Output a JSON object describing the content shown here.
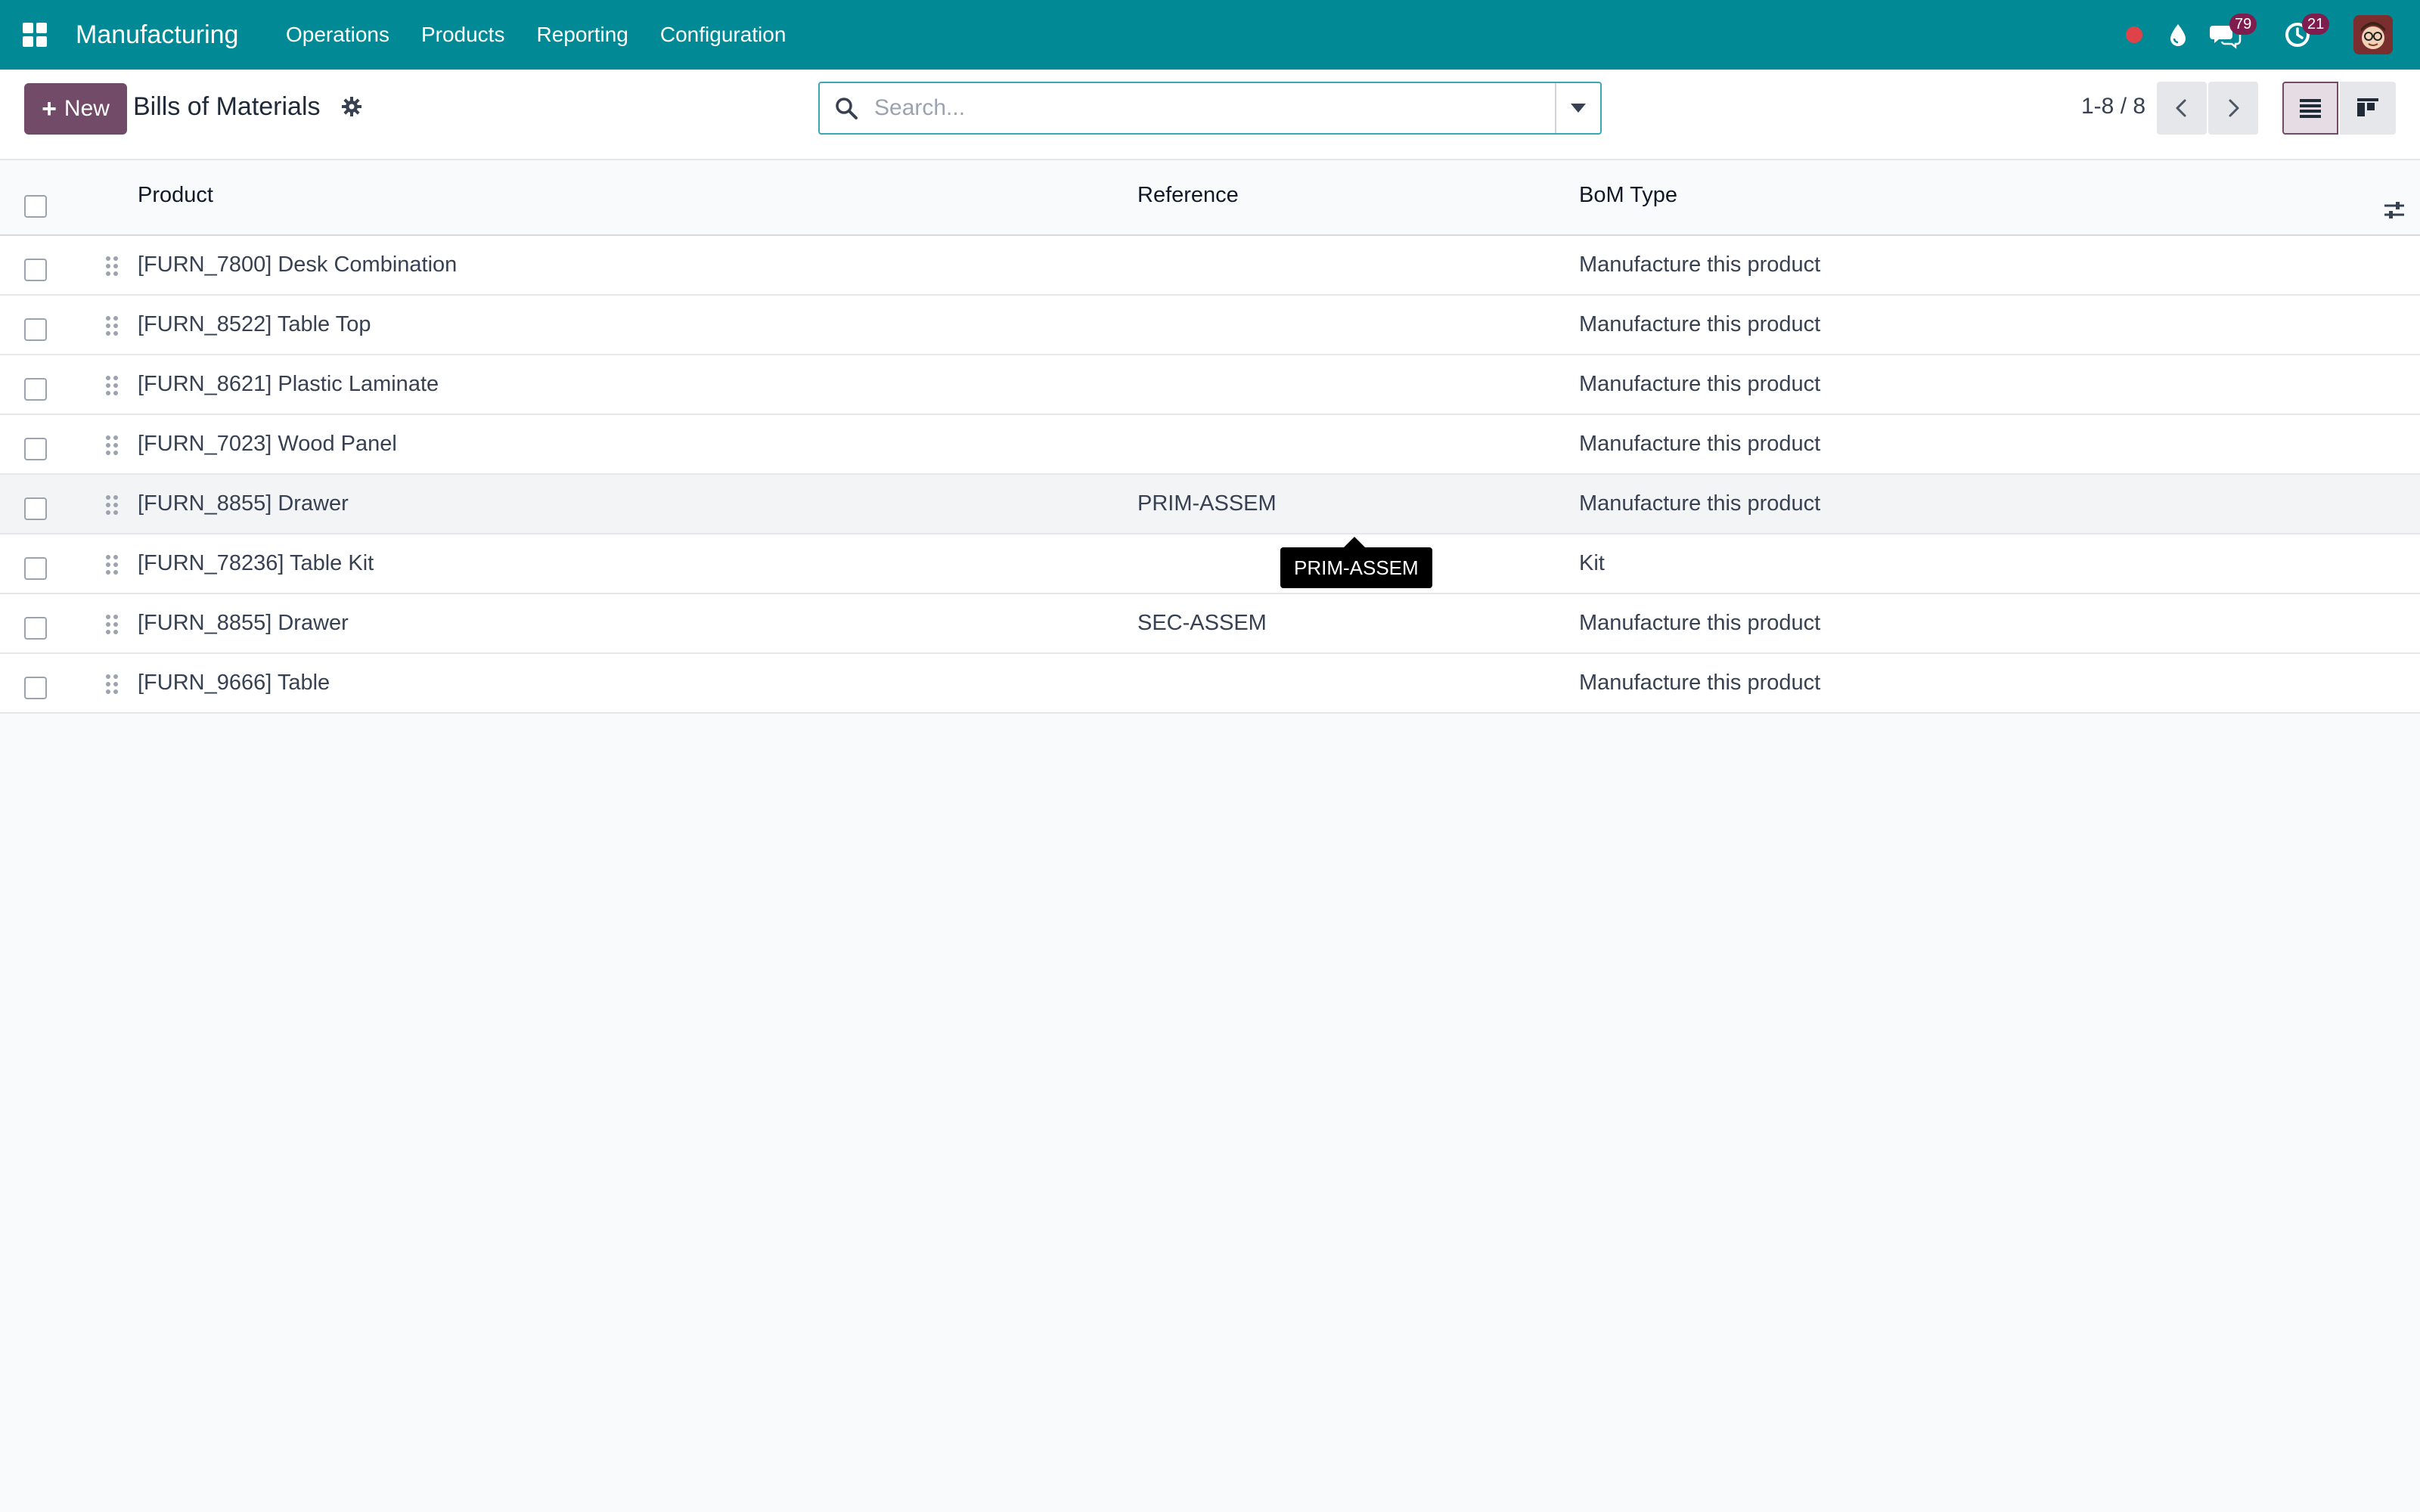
{
  "navbar": {
    "brand": "Manufacturing",
    "menu": [
      "Operations",
      "Products",
      "Reporting",
      "Configuration"
    ],
    "messages_badge": "79",
    "activities_badge": "21",
    "bg_color": "#018a96",
    "icons": [
      "apps-grid-icon",
      "recording-dot-icon",
      "droplet-icon",
      "chat-icon",
      "clock-icon"
    ]
  },
  "control_panel": {
    "new_label": "New",
    "title": "Bills of Materials",
    "search_placeholder": "Search...",
    "pager": "1-8 / 8",
    "active_view": "list",
    "accent_color": "#714b67"
  },
  "table": {
    "columns": [
      "Product",
      "Reference",
      "BoM Type"
    ],
    "rows": [
      {
        "product": "[FURN_7800] Desk Combination",
        "reference": "",
        "type": "Manufacture this product"
      },
      {
        "product": "[FURN_8522] Table Top",
        "reference": "",
        "type": "Manufacture this product"
      },
      {
        "product": "[FURN_8621] Plastic Laminate",
        "reference": "",
        "type": "Manufacture this product"
      },
      {
        "product": "[FURN_7023] Wood Panel",
        "reference": "",
        "type": "Manufacture this product"
      },
      {
        "product": "[FURN_8855] Drawer",
        "reference": "PRIM-ASSEM",
        "type": "Manufacture this product"
      },
      {
        "product": "[FURN_78236] Table Kit",
        "reference": "",
        "type": "Kit"
      },
      {
        "product": "[FURN_8855] Drawer",
        "reference": "SEC-ASSEM",
        "type": "Manufacture this product"
      },
      {
        "product": "[FURN_9666] Table",
        "reference": "",
        "type": "Manufacture this product"
      }
    ]
  },
  "tooltip": {
    "text": "PRIM-ASSEM"
  }
}
